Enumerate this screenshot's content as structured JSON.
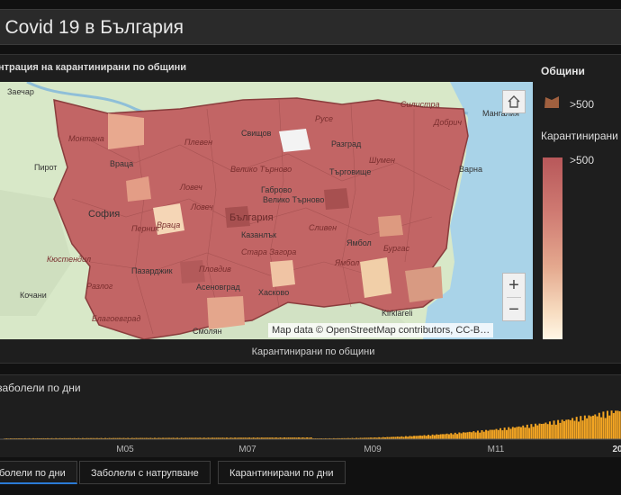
{
  "header": {
    "title": "n Covid 19 в България"
  },
  "map_panel": {
    "title": "нтрация на карантинирани по общини",
    "caption": "Карантинирани по общини",
    "attribution": "Map data © OpenStreetMap contributors, CC-B…",
    "zoom_in": "+",
    "zoom_out": "−",
    "place_labels": [
      {
        "text": "Заечар"
      },
      {
        "text": "Монтана"
      },
      {
        "text": "Плевен"
      },
      {
        "text": "Русе"
      },
      {
        "text": "Свищов"
      },
      {
        "text": "Силистра"
      },
      {
        "text": "Мангалия"
      },
      {
        "text": "Пирот"
      },
      {
        "text": "Враца"
      },
      {
        "text": "Ловеч"
      },
      {
        "text": "Велико Търново"
      },
      {
        "text": "Разград"
      },
      {
        "text": "Шумен"
      },
      {
        "text": "Търговище"
      },
      {
        "text": "Варна"
      },
      {
        "text": "Добрич"
      },
      {
        "text": "Габрово"
      },
      {
        "text": "Велико Търново"
      },
      {
        "text": "София"
      },
      {
        "text": "Перник"
      },
      {
        "text": "България"
      },
      {
        "text": "Сливен"
      },
      {
        "text": "Ямбол"
      },
      {
        "text": "Бургас"
      },
      {
        "text": "Казанлък"
      },
      {
        "text": "Стара Загора"
      },
      {
        "text": "Кюстендил"
      },
      {
        "text": "Пазарджик"
      },
      {
        "text": "Пловдив"
      },
      {
        "text": "Асеновград"
      },
      {
        "text": "Хасково"
      },
      {
        "text": "Ямбол"
      },
      {
        "text": "Кочани"
      },
      {
        "text": "Благоевград"
      },
      {
        "text": "Смолян"
      },
      {
        "text": "Kirklareli"
      },
      {
        "text": "Враца"
      },
      {
        "text": "Ловеч"
      },
      {
        "text": "Разлог"
      }
    ]
  },
  "legend": {
    "title": "Общини",
    "class_label": ">500",
    "ramp_title": "Карантинирани",
    "ramp_label": ">500"
  },
  "chart_panel": {
    "title": "заболели по дни",
    "chart_data": {
      "type": "bar",
      "title": "заболели по дни",
      "x_tick_labels": [
        "M05",
        "M07",
        "M09",
        "M11",
        "20"
      ],
      "bar_color": "#f5a623"
    }
  },
  "tabs": [
    {
      "label": "болели по дни",
      "active": true
    },
    {
      "label": "Заболели с натрупване",
      "active": false
    },
    {
      "label": "Карантинирани по дни",
      "active": false
    }
  ],
  "colors": {
    "background": "#111111",
    "region_fill": "#c26565",
    "sea": "#a9d3e8",
    "accent_tab": "#2b7bd6"
  }
}
